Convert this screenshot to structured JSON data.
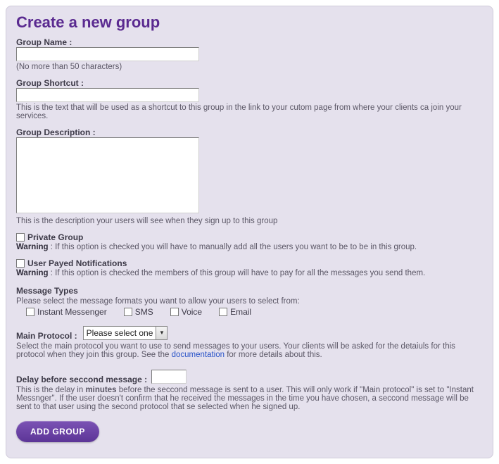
{
  "title": "Create a new group",
  "groupName": {
    "label": "Group Name :",
    "value": "",
    "hint": "(No more than 50 characters)"
  },
  "groupShortcut": {
    "label": "Group Shortcut :",
    "value": "",
    "hint": "This is the text that will be used as a shortcut to this group in the link to your cutom page from where your clients ca join your services."
  },
  "groupDescription": {
    "label": "Group Description :",
    "value": "",
    "hint": "This is the description your users will see when they sign up to this group"
  },
  "privateGroup": {
    "label": "Private Group",
    "warningLabel": "Warning",
    "warningText": " : If this option is checked you will have to manually add all the users you want to be to be in this group."
  },
  "payedNotifications": {
    "label": "User Payed Notifications",
    "warningLabel": "Warning",
    "warningText": " : If this option is checked the members of this group will have to pay for all the messages you send them."
  },
  "messageTypes": {
    "heading": "Message Types",
    "hint": "Please select the message formats you want to allow your users to select from:",
    "options": {
      "im": "Instant Messenger",
      "sms": "SMS",
      "voice": "Voice",
      "email": "Email"
    }
  },
  "mainProtocol": {
    "label": "Main Protocol :",
    "selected": "Please select one",
    "hintPrefix": "Select the main protocol you want to use to send messages to your users. Your clients will be asked for the detaiuls for this protocol when they join this group. See the ",
    "linkText": "documentation",
    "hintSuffix": " for more details about this."
  },
  "delay": {
    "label": "Delay before seccond message :",
    "value": "",
    "hintPrefix": "This is the delay in ",
    "boldWord": "minutes",
    "hintSuffix": " before the seccond message is sent to a user. This will only work if \"Main protocol\" is set to \"Instant Messnger\". If the user doesn't confirm that he received the messages in the time you have chosen, a seccond message will be sent to that user using the second protocol that se selected when he signed up."
  },
  "submit": {
    "label": "ADD GROUP"
  }
}
